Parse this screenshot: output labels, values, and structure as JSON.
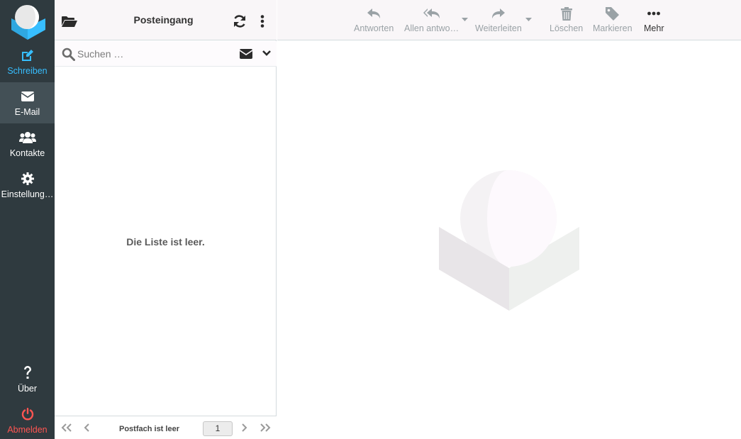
{
  "nav": {
    "compose": "Schreiben",
    "mail": "E-Mail",
    "contacts": "Kontakte",
    "settings": "Einstellung…",
    "about": "Über",
    "logout": "Abmelden"
  },
  "list": {
    "folder_title": "Posteingang",
    "search_placeholder": "Suchen …",
    "empty_message": "Die Liste ist leer.",
    "pager_status": "Postfach ist leer",
    "page_number": "1"
  },
  "toolbar": {
    "reply": "Antworten",
    "reply_all": "Allen antwo…",
    "forward": "Weiterleiten",
    "delete": "Löschen",
    "mark": "Markieren",
    "more": "Mehr"
  },
  "colors": {
    "nav_bg": "#2f3a3f",
    "accent": "#37beff",
    "logout": "#ff5552"
  }
}
